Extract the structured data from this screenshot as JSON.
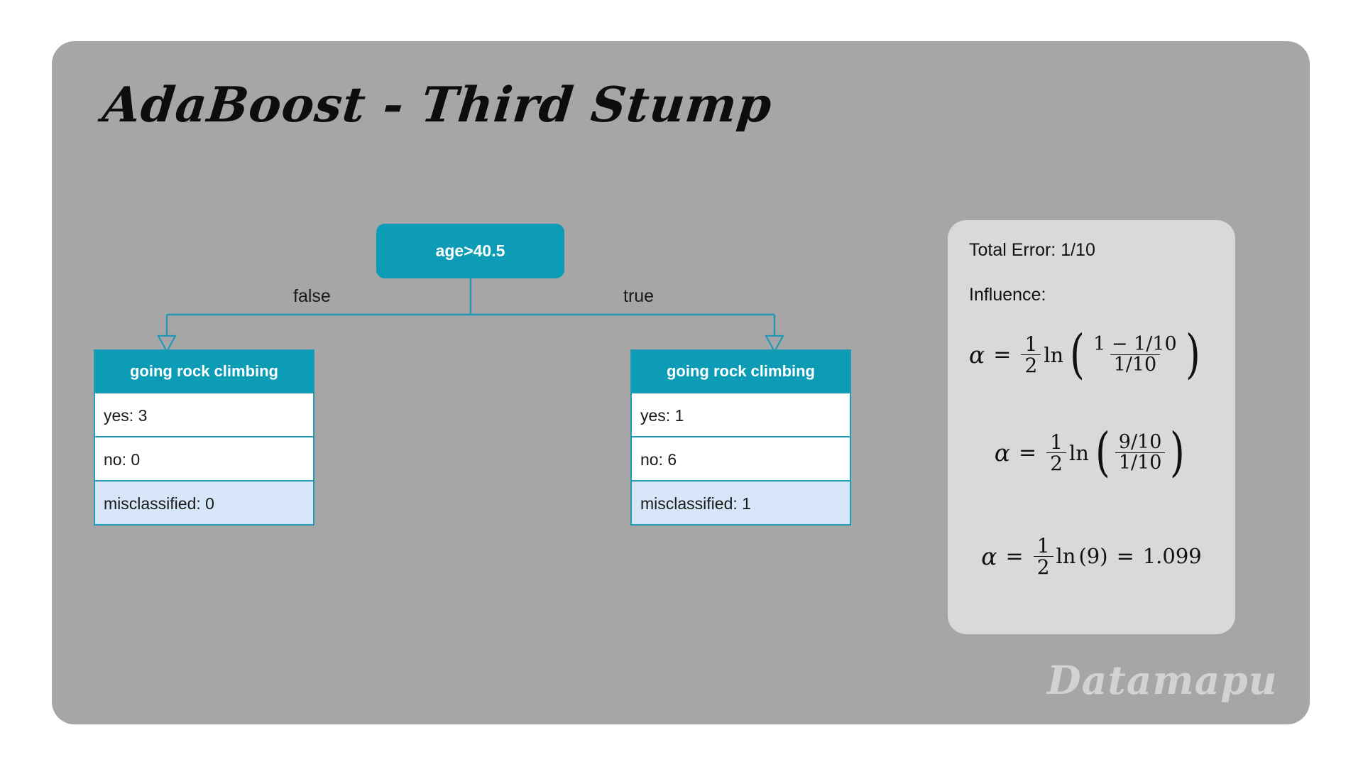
{
  "slide": {
    "title": "AdaBoost - Third Stump",
    "watermark": "Datamapu",
    "card_color": "#a6a6a6",
    "accent_color": "#0c9cb5",
    "highlight_color": "#d6e5f7",
    "panel_color": "#d9d9d9"
  },
  "tree": {
    "root": {
      "label": "age>40.5"
    },
    "edges": {
      "left_label": "false",
      "right_label": "true"
    },
    "leaves": [
      {
        "side": "left",
        "header": "going rock climbing",
        "rows": [
          {
            "label": "yes: 3",
            "highlight": false
          },
          {
            "label": "no: 0",
            "highlight": false
          },
          {
            "label": "misclassified: 0",
            "highlight": true
          }
        ]
      },
      {
        "side": "right",
        "header": "going rock climbing",
        "rows": [
          {
            "label": "yes: 1",
            "highlight": false
          },
          {
            "label": "no: 6",
            "highlight": false
          },
          {
            "label": "misclassified: 1",
            "highlight": true
          }
        ]
      }
    ]
  },
  "panel": {
    "total_error_line": "Total Error: 1/10",
    "influence_line": "Influence:",
    "equations": [
      {
        "id": "eq1",
        "text": "alpha = 1/2 ln( (1 - 1/10) / (1/10) )",
        "alpha": "α",
        "equals": "=",
        "half_num": "1",
        "half_den": "2",
        "ln": "ln",
        "open_paren": "(",
        "close_paren": ")",
        "frac_num": "1 − 1/10",
        "frac_den": "1/10"
      },
      {
        "id": "eq2",
        "text": "alpha = 1/2 ln( (9/10) / (1/10) )",
        "alpha": "α",
        "equals": "=",
        "half_num": "1",
        "half_den": "2",
        "ln": "ln",
        "open_paren": "(",
        "close_paren": ")",
        "frac_num": "9/10",
        "frac_den": "1/10"
      },
      {
        "id": "eq3",
        "text": "alpha = 1/2 ln(9) = 1.099",
        "alpha": "α",
        "equals": "=",
        "half_num": "1",
        "half_den": "2",
        "ln": "ln",
        "arg": "(9)",
        "equals2": "=",
        "result": "1.099"
      }
    ]
  },
  "chart_data": {
    "type": "diagram",
    "title": "AdaBoost - Third Stump",
    "root_split": "age>40.5",
    "branches": [
      {
        "condition": "false",
        "yes": 3,
        "no": 0,
        "misclassified": 0
      },
      {
        "condition": "true",
        "yes": 1,
        "no": 6,
        "misclassified": 1
      }
    ],
    "total_error": "1/10",
    "influence_alpha": 1.099
  }
}
